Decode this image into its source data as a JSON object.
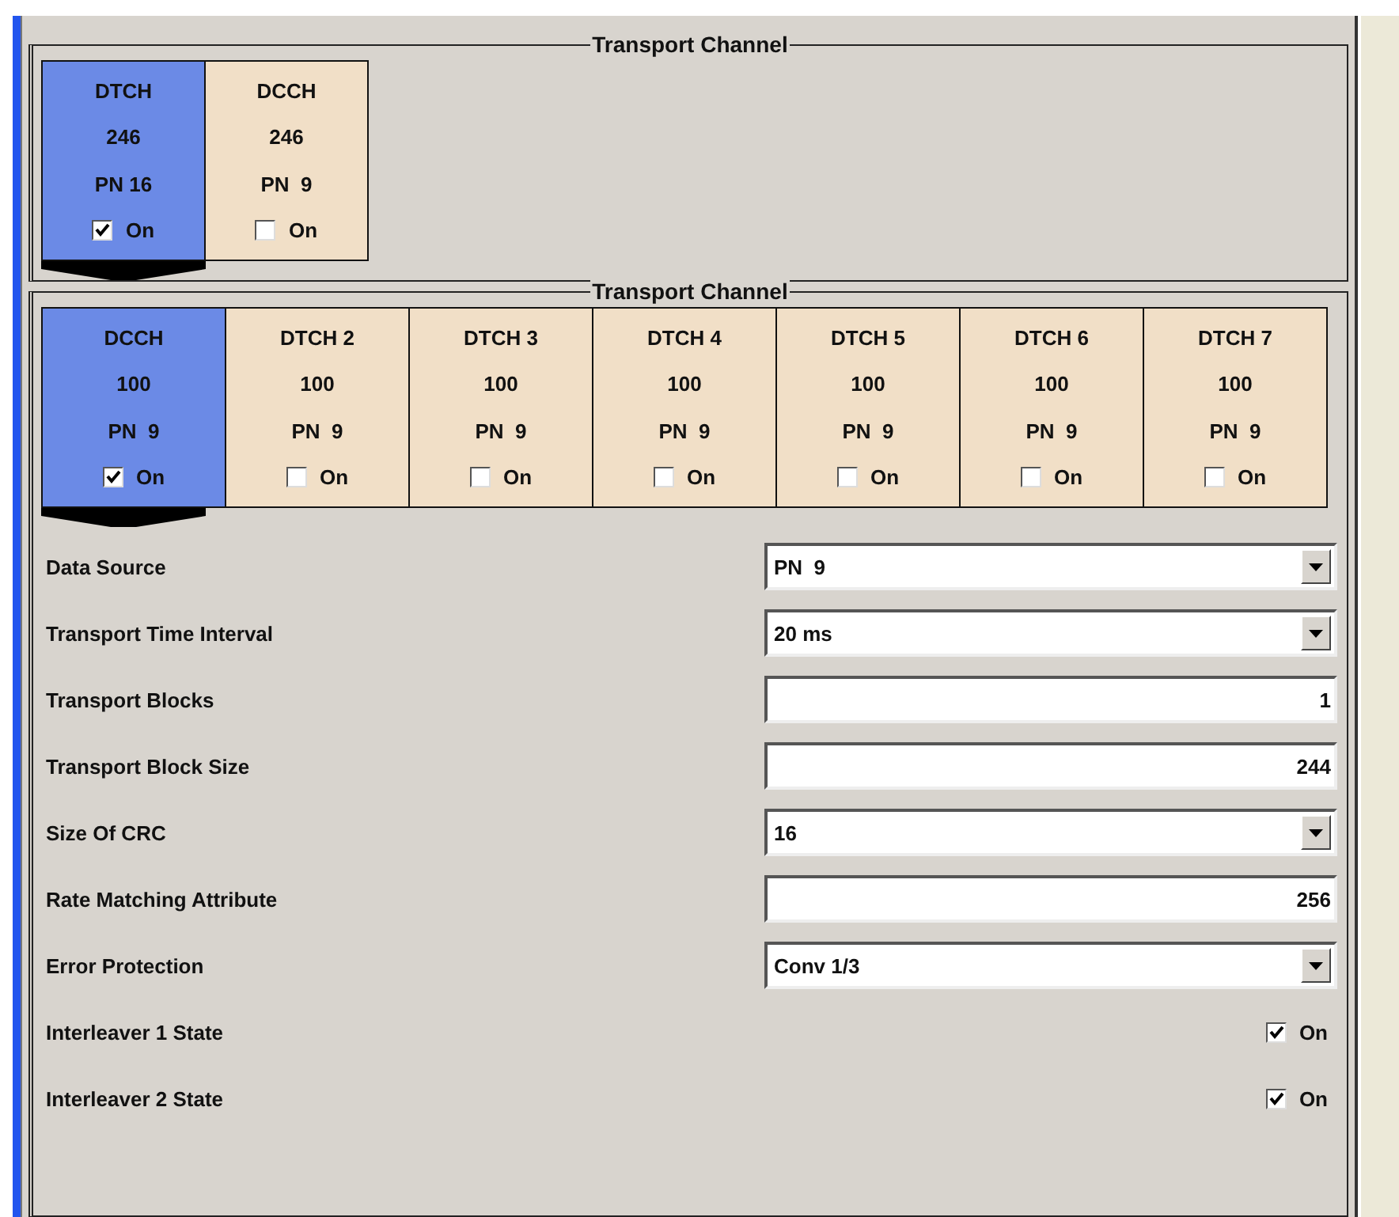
{
  "groups": [
    {
      "title": "Transport Channel",
      "tiles": [
        {
          "name": "DTCH",
          "size": "246",
          "source": "PN 16",
          "on_label": "On",
          "on": true,
          "selected": true
        },
        {
          "name": "DCCH",
          "size": "246",
          "source": "PN  9",
          "on_label": "On",
          "on": false,
          "selected": false
        }
      ]
    },
    {
      "title": "Transport Channel",
      "tiles": [
        {
          "name": "DCCH",
          "size": "100",
          "source": "PN  9",
          "on_label": "On",
          "on": true,
          "selected": true
        },
        {
          "name": "DTCH 2",
          "size": "100",
          "source": "PN  9",
          "on_label": "On",
          "on": false,
          "selected": false
        },
        {
          "name": "DTCH 3",
          "size": "100",
          "source": "PN  9",
          "on_label": "On",
          "on": false,
          "selected": false
        },
        {
          "name": "DTCH 4",
          "size": "100",
          "source": "PN  9",
          "on_label": "On",
          "on": false,
          "selected": false
        },
        {
          "name": "DTCH 5",
          "size": "100",
          "source": "PN  9",
          "on_label": "On",
          "on": false,
          "selected": false
        },
        {
          "name": "DTCH 6",
          "size": "100",
          "source": "PN  9",
          "on_label": "On",
          "on": false,
          "selected": false
        },
        {
          "name": "DTCH 7",
          "size": "100",
          "source": "PN  9",
          "on_label": "On",
          "on": false,
          "selected": false
        }
      ]
    }
  ],
  "parameters": [
    {
      "kind": "select",
      "label": "Data Source",
      "value": "PN  9"
    },
    {
      "kind": "select",
      "label": "Transport Time Interval",
      "value": "20 ms"
    },
    {
      "kind": "number",
      "label": "Transport Blocks",
      "value": "1"
    },
    {
      "kind": "number",
      "label": "Transport Block Size",
      "value": "244"
    },
    {
      "kind": "select",
      "label": "Size Of CRC",
      "value": "16"
    },
    {
      "kind": "number",
      "label": "Rate Matching Attribute",
      "value": "256"
    },
    {
      "kind": "select",
      "label": "Error Protection",
      "value": "Conv 1/3"
    },
    {
      "kind": "checkbox",
      "label": "Interleaver 1 State",
      "value": "On",
      "checked": true
    },
    {
      "kind": "checkbox",
      "label": "Interleaver 2 State",
      "value": "On",
      "checked": true
    }
  ]
}
